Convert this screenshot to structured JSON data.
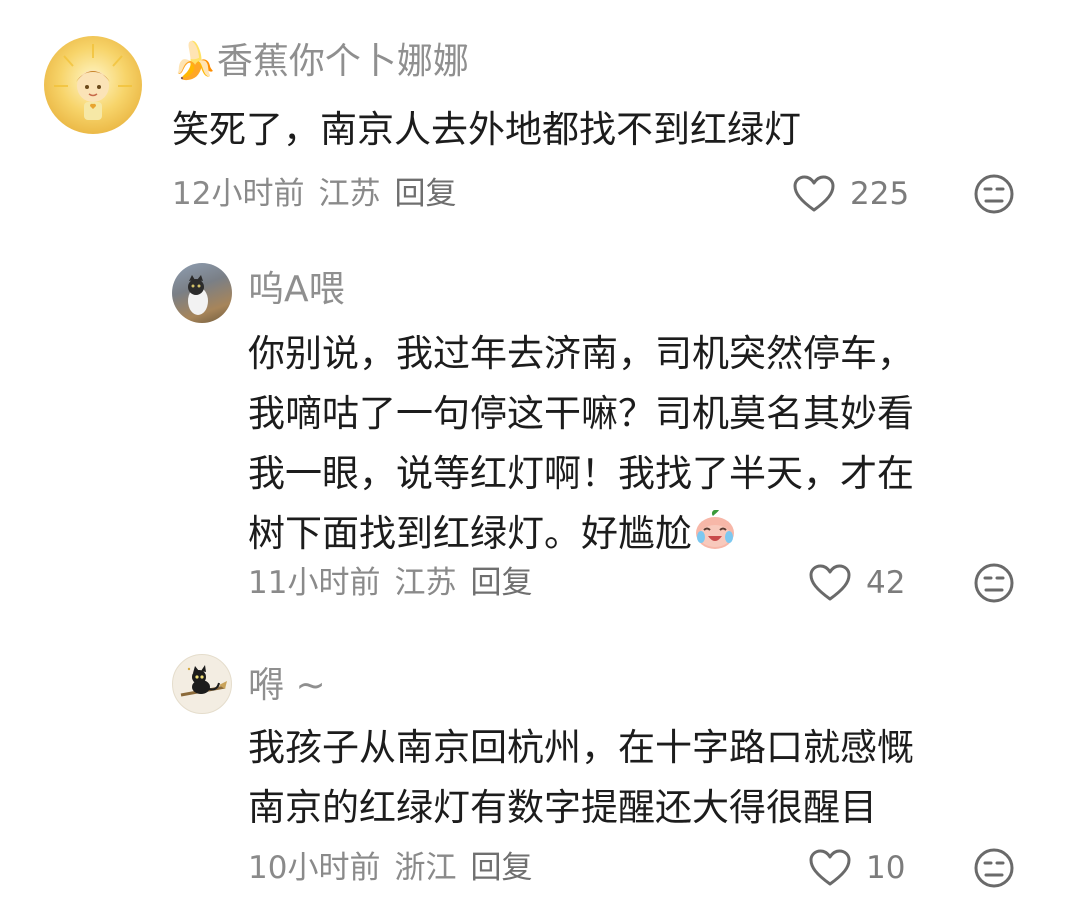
{
  "comments": [
    {
      "username": "🍌香蕉你个卜娜娜",
      "lines": [
        "笑死了，南京人去外地都找不到红绿灯"
      ],
      "time": "12小时前",
      "location": "江苏",
      "reply_label": "回复",
      "likes": "225",
      "avatar_icon": "sun-girl-avatar"
    },
    {
      "username": "呜A喂",
      "lines": [
        "你别说，我过年去济南，司机突然停车，",
        "我嘀咕了一句停这干嘛？司机莫名其妙看",
        "我一眼，说等红灯啊！我找了半天，才在",
        "树下面找到红绿灯。好尴尬"
      ],
      "emoji": "crying-laughing-peach-emoji",
      "time": "11小时前",
      "location": "江苏",
      "reply_label": "回复",
      "likes": "42",
      "avatar_icon": "cat-photo-avatar"
    },
    {
      "username": "嘚 ~",
      "lines": [
        "我孩子从南京回杭州，在十字路口就感慨",
        "南京的红绿灯有数字提醒还大得很醒目"
      ],
      "time": "10小时前",
      "location": "浙江",
      "reply_label": "回复",
      "likes": "10",
      "avatar_icon": "black-cat-witch-avatar"
    }
  ]
}
